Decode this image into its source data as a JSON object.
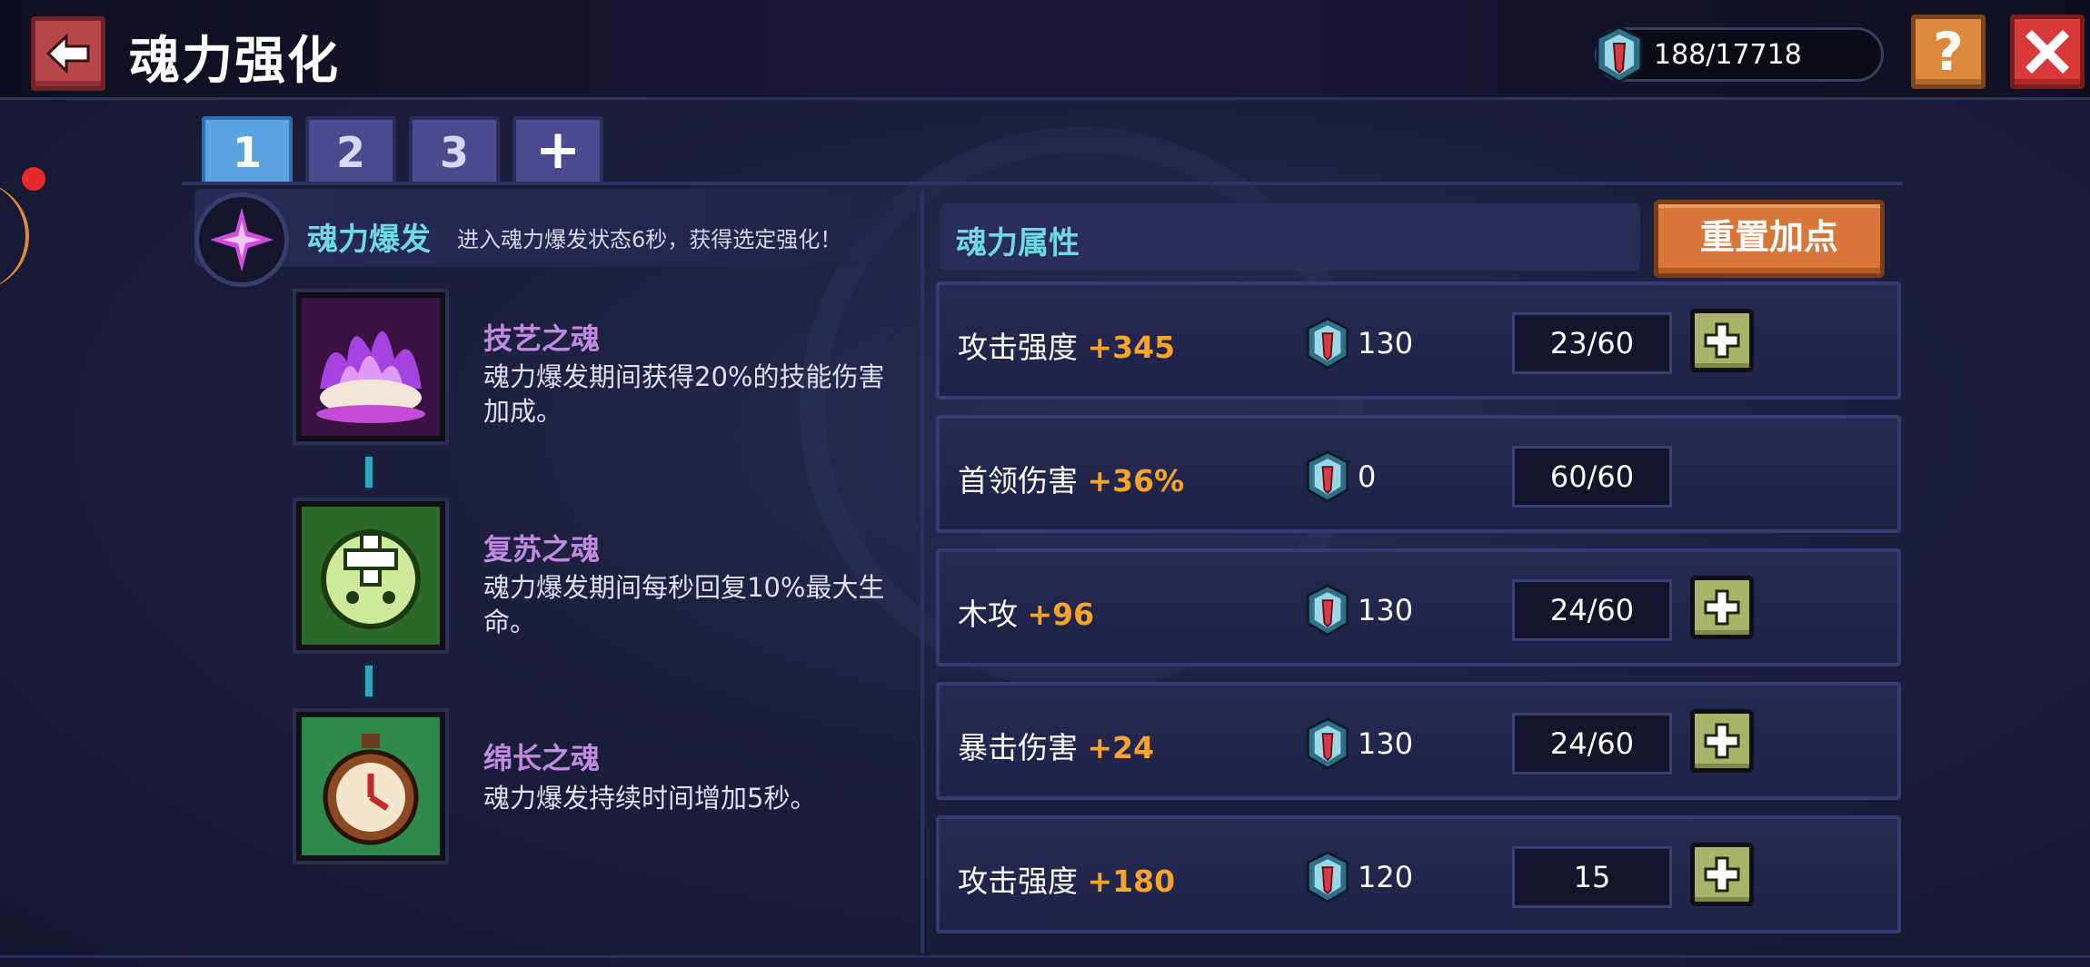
{
  "header": {
    "title": "魂力强化",
    "currency_value": "188/17718"
  },
  "tabs": [
    {
      "label": "1",
      "active": true
    },
    {
      "label": "2",
      "active": false
    },
    {
      "label": "3",
      "active": false
    },
    {
      "label": "+",
      "active": false
    }
  ],
  "burst": {
    "title": "魂力爆发",
    "description": "进入魂力爆发状态6秒，获得选定强化！"
  },
  "skills": [
    {
      "name": "技艺之魂",
      "description": "魂力爆发期间获得20%的技能伤害加成。",
      "icon": "purple-flame-icon"
    },
    {
      "name": "复苏之魂",
      "description": "魂力爆发期间每秒回复10%最大生命。",
      "icon": "green-heal-icon"
    },
    {
      "name": "绵长之魂",
      "description": "魂力爆发持续时间增加5秒。",
      "icon": "stopwatch-icon"
    }
  ],
  "attributes": {
    "title": "魂力属性",
    "reset_label": "重置加点",
    "rows": [
      {
        "label": "攻击强度",
        "bonus": "+345",
        "cost": "130",
        "level": "23/60",
        "can_upgrade": true
      },
      {
        "label": "首领伤害",
        "bonus": "+36%",
        "cost": "0",
        "level": "60/60",
        "can_upgrade": false
      },
      {
        "label": "木攻",
        "bonus": "+96",
        "cost": "130",
        "level": "24/60",
        "can_upgrade": true
      },
      {
        "label": "暴击伤害",
        "bonus": "+24",
        "cost": "130",
        "level": "24/60",
        "can_upgrade": true
      },
      {
        "label": "攻击强度",
        "bonus": "+180",
        "cost": "120",
        "level": "15",
        "can_upgrade": true
      }
    ]
  },
  "colors": {
    "accent_cyan": "#6fd8e6",
    "bonus_orange": "#f7a52a",
    "skill_purple": "#c08ae0"
  }
}
